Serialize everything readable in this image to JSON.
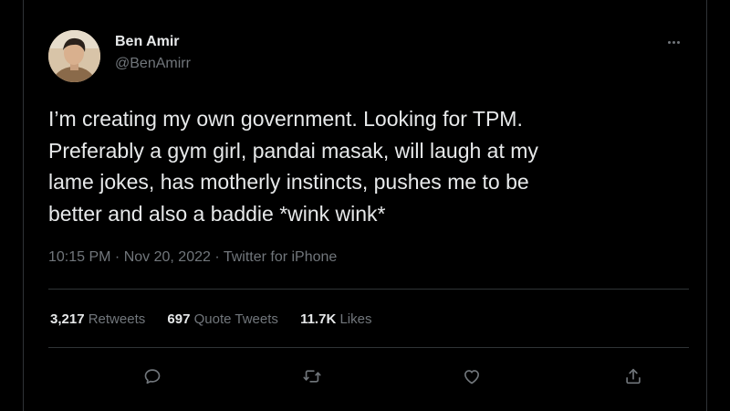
{
  "tweet": {
    "author": {
      "display_name": "Ben Amir",
      "handle": "@BenAmirr"
    },
    "text": "I’m creating my own government. Looking for TPM.\nPreferably a gym girl, pandai masak, will laugh at my\nlame jokes, has motherly instincts, pushes me to be\nbetter and also a baddie *wink wink*",
    "meta": "10:15 PM · Nov 20, 2022 · Twitter for iPhone",
    "stats": {
      "retweets": {
        "count": "3,217",
        "label": "Retweets"
      },
      "quotes": {
        "count": "697",
        "label": "Quote Tweets"
      },
      "likes": {
        "count": "11.7K",
        "label": "Likes"
      }
    },
    "actions": [
      "reply-icon",
      "retweet-icon",
      "like-icon",
      "share-icon"
    ]
  },
  "colors": {
    "background": "#000000",
    "text_primary": "#e7e9ea",
    "text_secondary": "#71767b",
    "border": "#2f3336"
  }
}
